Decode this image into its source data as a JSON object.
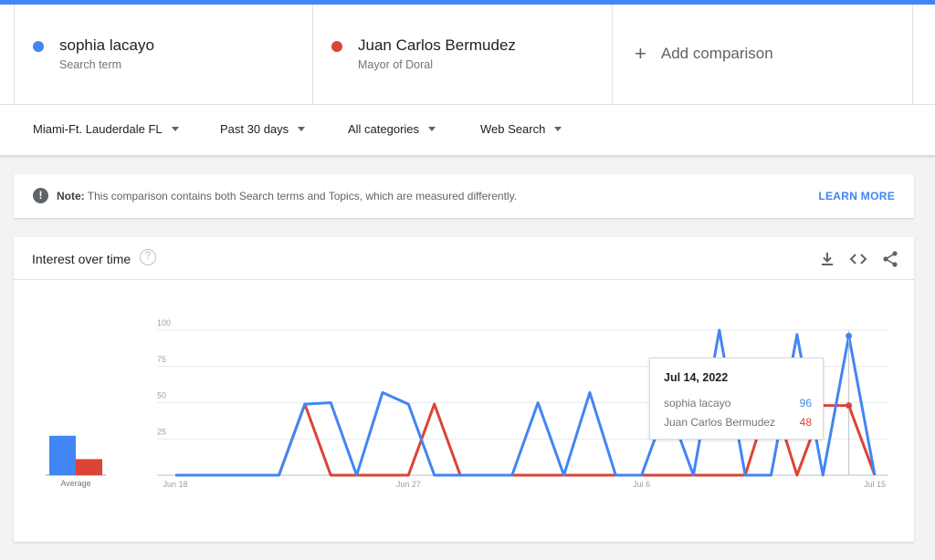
{
  "terms": [
    {
      "name": "sophia lacayo",
      "sub": "Search term",
      "color": "#4285f4"
    },
    {
      "name": "Juan Carlos Bermudez",
      "sub": "Mayor of Doral",
      "color": "#db4437"
    }
  ],
  "add_comparison": "Add comparison",
  "filters": {
    "region": "Miami-Ft. Lauderdale FL",
    "time": "Past 30 days",
    "category": "All categories",
    "search_type": "Web Search"
  },
  "note": {
    "label": "Note:",
    "text": "This comparison contains both Search terms and Topics, which are measured differently.",
    "action": "LEARN MORE"
  },
  "card": {
    "title": "Interest over time",
    "icons": [
      "download-icon",
      "embed-icon",
      "share-icon"
    ]
  },
  "tooltip": {
    "date": "Jul 14, 2022",
    "rows": [
      {
        "name": "sophia lacayo",
        "value": "96",
        "color": "#4285f4"
      },
      {
        "name": "Juan Carlos Bermudez",
        "value": "48",
        "color": "#db4437"
      }
    ]
  },
  "chart_data": {
    "type": "line",
    "average_label": "Average",
    "averages": [
      {
        "series": "sophia lacayo",
        "value": 27
      },
      {
        "series": "Juan Carlos Bermudez",
        "value": 11
      }
    ],
    "x_tick_labels": [
      "Jun 18",
      "Jun 27",
      "Jul 6",
      "Jul 15"
    ],
    "y_ticks": [
      25,
      50,
      75,
      100
    ],
    "ylim": [
      0,
      100
    ],
    "x": [
      "Jun 18",
      "Jun 19",
      "Jun 20",
      "Jun 21",
      "Jun 22",
      "Jun 23",
      "Jun 24",
      "Jun 25",
      "Jun 26",
      "Jun 27",
      "Jun 28",
      "Jun 29",
      "Jun 30",
      "Jul 1",
      "Jul 2",
      "Jul 3",
      "Jul 4",
      "Jul 5",
      "Jul 6",
      "Jul 7",
      "Jul 8",
      "Jul 9",
      "Jul 10",
      "Jul 11",
      "Jul 12",
      "Jul 13",
      "Jul 14",
      "Jul 15"
    ],
    "series": [
      {
        "name": "sophia lacayo",
        "color": "#4285f4",
        "values": [
          0,
          0,
          0,
          0,
          0,
          49,
          50,
          0,
          57,
          49,
          0,
          0,
          0,
          0,
          50,
          0,
          57,
          0,
          0,
          49,
          0,
          100,
          0,
          0,
          97,
          0,
          96,
          0
        ]
      },
      {
        "name": "Juan Carlos Bermudez",
        "color": "#db4437",
        "values": [
          0,
          0,
          0,
          0,
          0,
          49,
          0,
          0,
          0,
          0,
          49,
          0,
          0,
          0,
          0,
          0,
          0,
          0,
          0,
          0,
          0,
          0,
          0,
          57,
          0,
          48,
          48,
          0
        ]
      }
    ],
    "highlight": "Jul 14"
  }
}
